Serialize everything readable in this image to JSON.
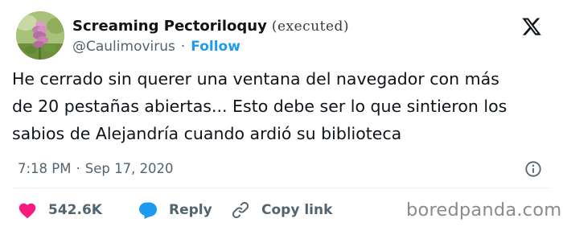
{
  "author": {
    "display_name": "Screaming Pectoriloquy",
    "name_suffix": "(executed)",
    "handle": "@Caulimovirus",
    "separator": "·",
    "follow_label": "Follow"
  },
  "tweet": {
    "text_lines": [
      "He cerrado sin querer una ventana del navegador con más",
      "de 20 pestañas abiertas... Esto debe ser lo que sintieron los",
      "sabios de Alejandría cuando ardió su biblioteca"
    ],
    "time": "7:18 PM",
    "date_separator": "·",
    "date": "Sep 17, 2020"
  },
  "actions": {
    "like_count": "542.6K",
    "reply_label": "Reply",
    "copy_label": "Copy link"
  },
  "watermark": "boredpanda.com",
  "colors": {
    "accent": "#1d9bf0",
    "like": "#f91880",
    "text": "#0f1419",
    "secondary": "#536471"
  },
  "icons": {
    "platform": "x-logo-icon",
    "info": "info-icon",
    "like": "heart-icon",
    "reply": "reply-bubble-icon",
    "copy": "link-icon"
  }
}
